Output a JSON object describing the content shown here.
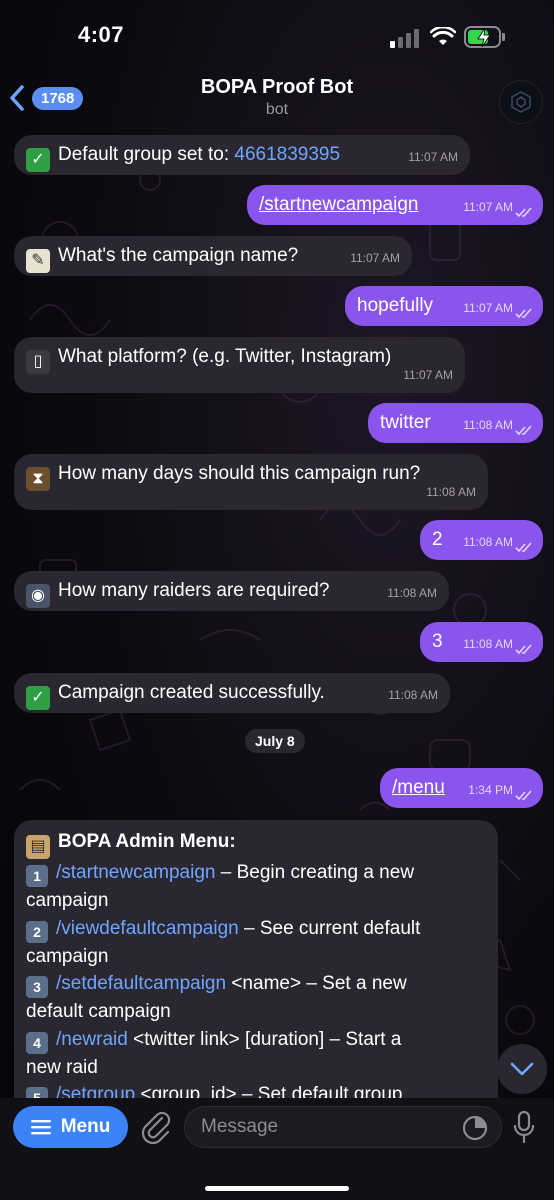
{
  "status_bar": {
    "time": "4:07"
  },
  "header": {
    "back_count": "1768",
    "title": "BOPA Proof Bot",
    "subtitle": "bot"
  },
  "messages": [
    {
      "dir": "in",
      "emoji": "check-mark",
      "text": "Default group set to: ",
      "link": "4661839395",
      "time": "11:07 AM"
    },
    {
      "dir": "out",
      "command": "/startnewcampaign",
      "time": "11:07 AM"
    },
    {
      "dir": "in",
      "emoji": "memo",
      "text": "What's the campaign name?",
      "time": "11:07 AM"
    },
    {
      "dir": "out",
      "text": "hopefully",
      "time": "11:07 AM"
    },
    {
      "dir": "in",
      "emoji": "mobile-phone",
      "text": "What platform? (e.g. Twitter, Instagram)",
      "time": "11:07 AM"
    },
    {
      "dir": "out",
      "text": "twitter",
      "time": "11:08 AM"
    },
    {
      "dir": "in",
      "emoji": "hourglass",
      "text": "How many days should this campaign run?",
      "time": "11:08 AM"
    },
    {
      "dir": "out",
      "text": "2",
      "time": "11:08 AM"
    },
    {
      "dir": "in",
      "emoji": "people",
      "text": "How many raiders are required?",
      "time": "11:08 AM"
    },
    {
      "dir": "out",
      "text": "3",
      "time": "11:08 AM"
    },
    {
      "dir": "in",
      "emoji": "check-mark",
      "text": "Campaign created successfully.",
      "time": "11:08 AM"
    }
  ],
  "date_chip": "July 8",
  "menu_command": {
    "command": "/menu",
    "time": "1:34 PM"
  },
  "admin_menu": {
    "title": "BOPA Admin Menu:",
    "items": [
      {
        "num": "1",
        "cmd": "/startnewcampaign",
        "rest": " – Begin creating a new",
        "cont": "campaign"
      },
      {
        "num": "2",
        "cmd": "/viewdefaultcampaign",
        "rest": " – See current default",
        "cont": "campaign"
      },
      {
        "num": "3",
        "cmd": "/setdefaultcampaign",
        "rest": " <name> – Set a new",
        "cont": "default campaign"
      },
      {
        "num": "4",
        "cmd": "/newraid",
        "rest": " <twitter link> [duration] – Start a",
        "cont": "new raid"
      },
      {
        "num": "5",
        "cmd": "/setgroup",
        "rest": " <group_id> – Set default group",
        "cont": ""
      }
    ]
  },
  "composer": {
    "menu_label": "Menu",
    "placeholder": "Message"
  },
  "colors": {
    "outgoing_bubble": "#8a55ec",
    "incoming_bubble": "#2b2730",
    "link": "#6ea6ff",
    "accent": "#3b83f6"
  }
}
